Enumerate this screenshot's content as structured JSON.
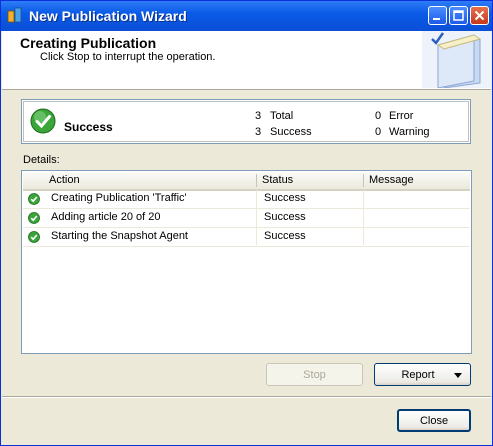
{
  "window": {
    "title": "New Publication Wizard"
  },
  "header": {
    "title": "Creating Publication",
    "subtitle": "Click Stop to interrupt the operation."
  },
  "summary": {
    "status": "Success",
    "total_count": "3",
    "total_label": "Total",
    "success_count": "3",
    "success_label": "Success",
    "error_count": "0",
    "error_label": "Error",
    "warning_count": "0",
    "warning_label": "Warning"
  },
  "details": {
    "label": "Details:",
    "columns": [
      "Action",
      "Status",
      "Message"
    ],
    "rows": [
      {
        "action": "Creating Publication 'Traffic'",
        "status": "Success",
        "message": ""
      },
      {
        "action": "Adding article 20 of 20",
        "status": "Success",
        "message": ""
      },
      {
        "action": "Starting the Snapshot Agent",
        "status": "Success",
        "message": ""
      }
    ]
  },
  "buttons": {
    "stop": "Stop",
    "report": "Report",
    "close": "Close"
  },
  "colors": {
    "success_green": "#3aa63a",
    "title_bar": "#0a5be8"
  }
}
